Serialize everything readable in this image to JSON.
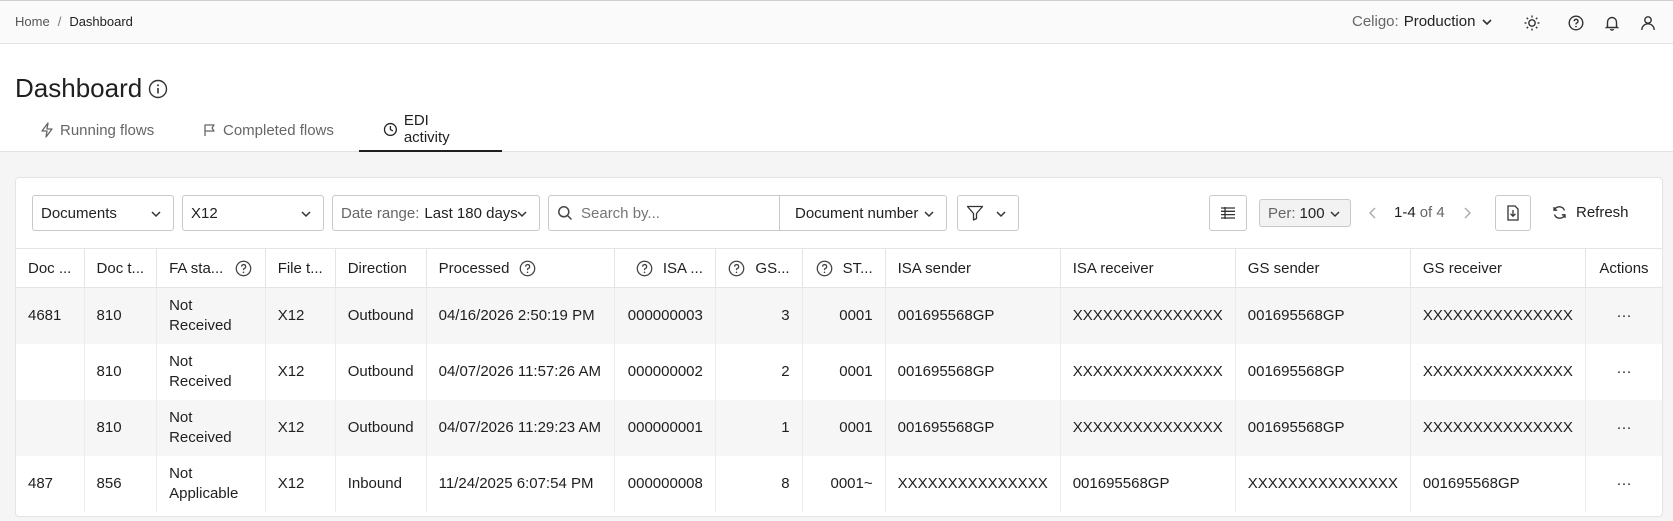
{
  "breadcrumb": {
    "home": "Home",
    "separator": "/",
    "current": "Dashboard"
  },
  "topbar": {
    "account_label": "Celigo:",
    "environment": "Production"
  },
  "page": {
    "title": "Dashboard"
  },
  "tabs": [
    {
      "label": "Running flows",
      "icon": "bolt-icon",
      "active": false
    },
    {
      "label": "Completed flows",
      "icon": "flag-icon",
      "active": false
    },
    {
      "label": "EDI activity",
      "icon": "clock-icon",
      "active": true
    }
  ],
  "filters": {
    "doc_type": "Documents",
    "file_type": "X12",
    "date_range_label": "Date range:",
    "date_range_value": "Last 180 days",
    "search_placeholder": "Search by...",
    "search_field": "Document number",
    "per_page_label": "Per:",
    "per_page_value": "100",
    "pagination": "1-4",
    "pagination_of": "of 4",
    "refresh_label": "Refresh"
  },
  "table": {
    "columns": [
      "Doc ...",
      "Doc t...",
      "FA sta...",
      "File t...",
      "Direction",
      "Processed",
      "ISA ...",
      "GS...",
      "ST...",
      "ISA sender",
      "ISA receiver",
      "GS sender",
      "GS receiver",
      "Actions"
    ],
    "rows": [
      {
        "doc_id": "4681",
        "doc_type": "810",
        "fa_status": "Not Received",
        "file_type": "X12",
        "direction": "Outbound",
        "processed": "04/16/2026 2:50:19 PM",
        "isa": "000000003",
        "gs": "3",
        "st": "0001",
        "isa_sender": "001695568GP",
        "isa_receiver": "XXXXXXXXXXXXXXX",
        "gs_sender": "001695568GP",
        "gs_receiver": "XXXXXXXXXXXXXXX",
        "actions": "···"
      },
      {
        "doc_id": "",
        "doc_type": "810",
        "fa_status": "Not Received",
        "file_type": "X12",
        "direction": "Outbound",
        "processed": "04/07/2026 11:57:26 AM",
        "isa": "000000002",
        "gs": "2",
        "st": "0001",
        "isa_sender": "001695568GP",
        "isa_receiver": "XXXXXXXXXXXXXXX",
        "gs_sender": "001695568GP",
        "gs_receiver": "XXXXXXXXXXXXXXX",
        "actions": "···"
      },
      {
        "doc_id": "",
        "doc_type": "810",
        "fa_status": "Not Received",
        "file_type": "X12",
        "direction": "Outbound",
        "processed": "04/07/2026 11:29:23 AM",
        "isa": "000000001",
        "gs": "1",
        "st": "0001",
        "isa_sender": "001695568GP",
        "isa_receiver": "XXXXXXXXXXXXXXX",
        "gs_sender": "001695568GP",
        "gs_receiver": "XXXXXXXXXXXXXXX",
        "actions": "···"
      },
      {
        "doc_id": "487",
        "doc_type": "856",
        "fa_status": "Not Applicable",
        "file_type": "X12",
        "direction": "Inbound",
        "processed": "11/24/2025 6:07:54 PM",
        "isa": "000000008",
        "gs": "8",
        "st": "0001~",
        "isa_sender": "XXXXXXXXXXXXXXX",
        "isa_receiver": "001695568GP",
        "gs_sender": "XXXXXXXXXXXXXXX",
        "gs_receiver": "001695568GP",
        "actions": "···"
      }
    ]
  }
}
